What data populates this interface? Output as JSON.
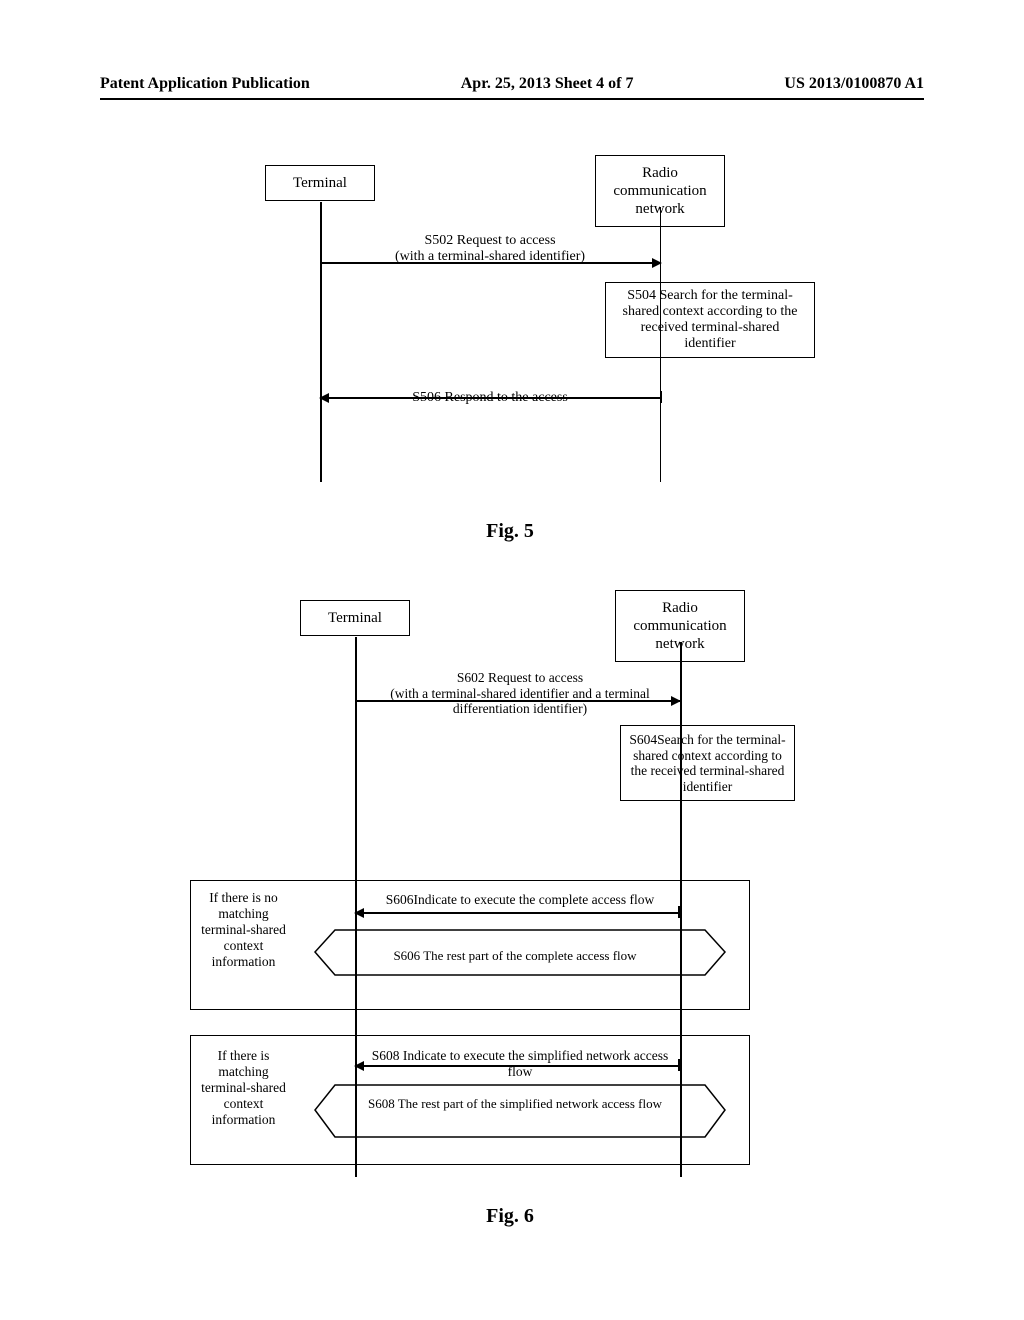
{
  "header": {
    "left": "Patent Application Publication",
    "center": "Apr. 25, 2013  Sheet 4 of 7",
    "right": "US 2013/0100870 A1"
  },
  "fig5": {
    "terminal": "Terminal",
    "network": "Radio communication network",
    "s502": "S502 Request to access\n(with a terminal-shared identifier)",
    "s504": "S504 Search for the terminal-shared context according to the received terminal-shared identifier",
    "s506": "S506 Respond to the access",
    "caption": "Fig. 5"
  },
  "fig6": {
    "terminal": "Terminal",
    "network": "Radio communication network",
    "s602": "S602 Request to access\n(with a terminal-shared identifier and a terminal differentiation identifier)",
    "s604": "S604Search for the terminal-shared context according to the received terminal-shared identifier",
    "group1_label": "If there is no matching terminal-shared context information",
    "s606": "S606Indicate to execute the complete access flow",
    "s606_rest": "S606 The rest part of the complete access flow",
    "group2_label": "If there is matching terminal-shared context information",
    "s608": "S608 Indicate to execute the simplified network access flow",
    "s608_rest": "S608 The rest part of the simplified network access flow",
    "caption": "Fig. 6"
  }
}
